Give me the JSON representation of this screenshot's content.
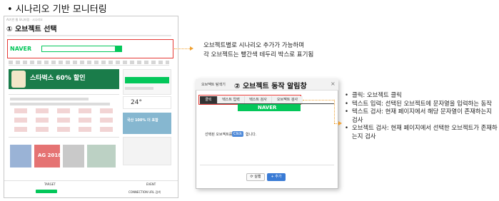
{
  "slide": {
    "title": "• 시나리오 기반 모니터링"
  },
  "browser": {
    "tiny_header": "AI기반 웹 모니터링 · 시나리오",
    "section1_title": "① 오브젝트 선택",
    "naver_logo": "NAVER",
    "ad_text": "스타벅스 60% 할인",
    "weather_temp": "24°",
    "ad_blue_text": "국산 100% 더 포함",
    "ag_text": "AG 2018",
    "bottom_target": "TARGET",
    "bottom_event": "EVENT",
    "bottom_connection": "CONNECTION URL 검색"
  },
  "note1": {
    "line1": "오브젝트별로 시나리오 추가가 가능하며",
    "line2": "각 오브젝트는 빨간색 테두리 박스로 표기됨"
  },
  "dialog": {
    "title_small": "오브젝트 탐색기",
    "section2_title": "② 오브젝트 동작 알림창",
    "close_label": "×",
    "tabs": [
      {
        "label": "클릭"
      },
      {
        "label": "텍스트 입력"
      },
      {
        "label": "텍스트 검사"
      },
      {
        "label": "오브젝트 검사"
      }
    ],
    "naver_strip": "NAVER",
    "hint_prefix": "선택된 오브젝트를",
    "click_badge": "Click",
    "hint_suffix": "합니다.",
    "btn_execute": "⟳ 실행",
    "btn_add": "+ 추가"
  },
  "bullets": [
    "클릭: 오브젝트 클릭",
    "텍스트 입력: 선택된 오브젝트에 문자열을 입력하는 동작",
    "텍스트 검사: 현재 페이지에서 해당 문자열이 존재하는지 검사",
    "오브젝트 검사: 현재 페이지에서 선택한 오브젝트가 존재하는지 검사"
  ],
  "colors": {
    "accent": "#f0a030",
    "red_box": "#e53935",
    "naver_green": "#03c75a",
    "button_blue": "#3a7bd5"
  }
}
